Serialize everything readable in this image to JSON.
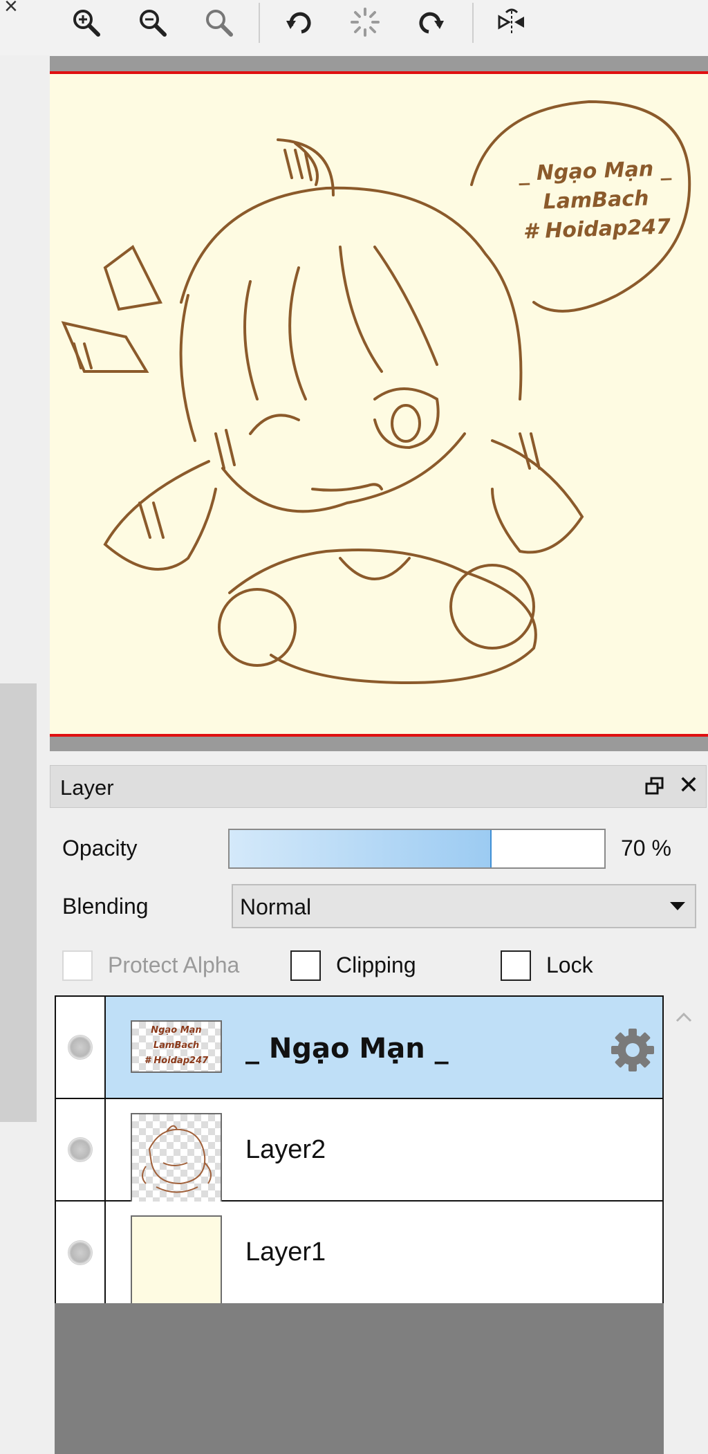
{
  "toolbar": {
    "tools": [
      {
        "icon": "zoom-in-icon"
      },
      {
        "icon": "zoom-out-icon"
      },
      {
        "icon": "zoom-reset-icon"
      },
      {
        "icon": "rotate-left-icon"
      },
      {
        "icon": "rotate-reset-icon"
      },
      {
        "icon": "rotate-right-icon"
      },
      {
        "icon": "flip-horizontal-icon"
      }
    ]
  },
  "canvas": {
    "bubble_lines": [
      "_ Ngạo Mạn _",
      "LamBach",
      "# Hoidap247"
    ],
    "paper_color": "#fefbe2",
    "ink_color": "#8b5a2b"
  },
  "layer_panel": {
    "title": "Layer",
    "opacity_label": "Opacity",
    "opacity_value": 0.7,
    "opacity_text": "70 %",
    "blending_label": "Blending",
    "blending_value": "Normal",
    "protect_alpha_label": "Protect Alpha",
    "clipping_label": "Clipping",
    "lock_label": "Lock",
    "layers": [
      {
        "name": "_ Ngạo Mạn _",
        "selected": true,
        "thumb_text": [
          "Ngạo Mạn",
          "LamBach",
          "# Hoidap247"
        ]
      },
      {
        "name": "Layer2",
        "selected": false
      },
      {
        "name": "Layer1",
        "selected": false
      }
    ],
    "selection_color": "#bfdff7"
  }
}
